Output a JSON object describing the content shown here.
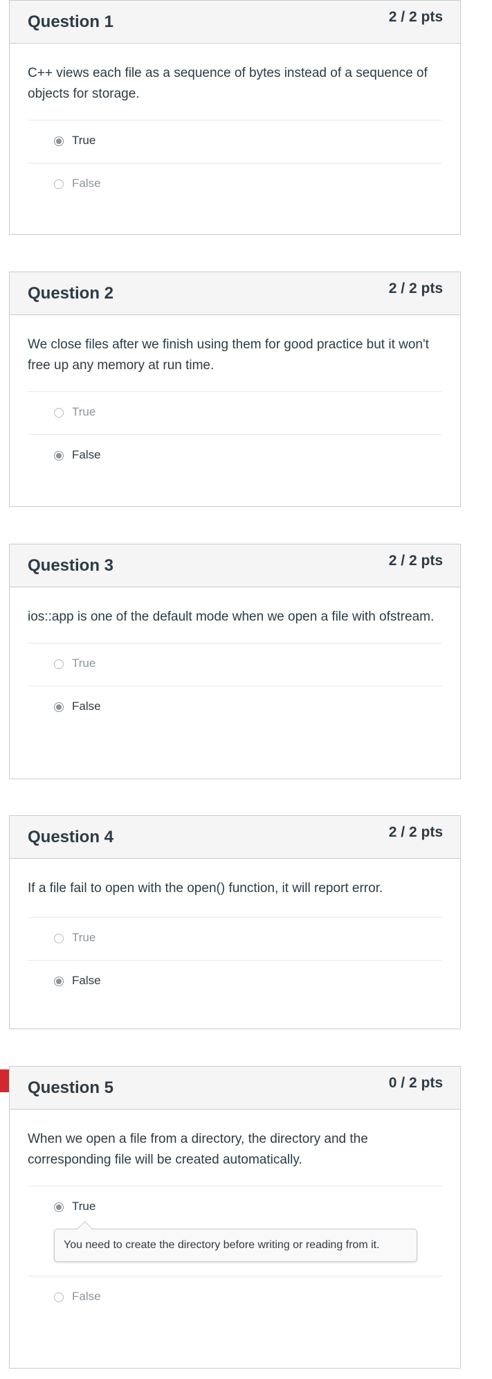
{
  "questions": [
    {
      "title": "Question 1",
      "points": "2 / 2 pts",
      "text": "C++ views each file as a sequence of bytes instead of a sequence of objects for storage.",
      "answers": [
        {
          "label": "True",
          "selected": true
        },
        {
          "label": "False",
          "selected": false
        }
      ]
    },
    {
      "title": "Question 2",
      "points": "2 / 2 pts",
      "text": "We close files after we finish using them for good practice but it won't free up any memory at run time.",
      "answers": [
        {
          "label": "True",
          "selected": false
        },
        {
          "label": "False",
          "selected": true
        }
      ]
    },
    {
      "title": "Question 3",
      "points": "2 / 2 pts",
      "text": "ios::app is one of the default mode when we open a file with ofstream.",
      "answers": [
        {
          "label": "True",
          "selected": false
        },
        {
          "label": "False",
          "selected": true
        }
      ]
    },
    {
      "title": "Question 4",
      "points": "2 / 2 pts",
      "text": "If a file fail to open with the open() function, it will report error.",
      "answers": [
        {
          "label": "True",
          "selected": false
        },
        {
          "label": "False",
          "selected": true
        }
      ]
    },
    {
      "title": "Question 5",
      "points": "0 / 2 pts",
      "text": "When we open a file from a directory, the directory and the corresponding file will be created automatically.",
      "answers": [
        {
          "label": "True",
          "selected": true
        },
        {
          "label": "False",
          "selected": false
        }
      ],
      "comment": "You need to create the directory before writing or reading from it.",
      "flag": "incorrect-flag-icon"
    }
  ],
  "colors": {
    "header_bg": "#f5f5f5",
    "border": "#c7cdd1",
    "text": "#2d3b45",
    "muted": "#8d959a",
    "flag": "#d1282e"
  }
}
